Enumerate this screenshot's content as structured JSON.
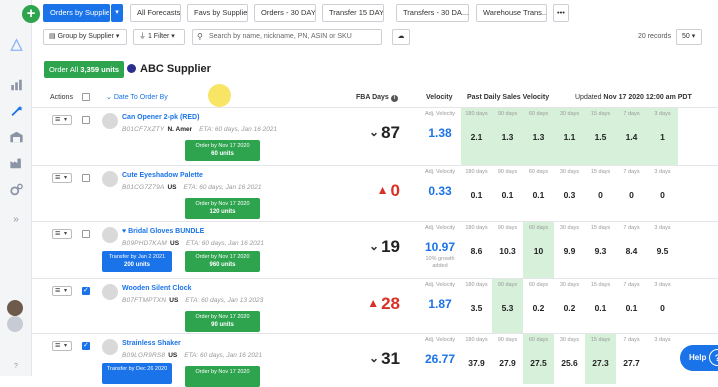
{
  "tabs": [
    {
      "label": "Orders by Supplier",
      "active": true
    },
    {
      "label": "All Forecasts"
    },
    {
      "label": "Favs by Supplier"
    },
    {
      "label": "Orders - 30 DAYS"
    },
    {
      "label": "Transfer 15 DAYS"
    },
    {
      "label": "Transfers - 30 DA..."
    },
    {
      "label": "Warehouse Trans..."
    },
    {
      "label": "•••"
    }
  ],
  "toolbar": {
    "group_label": "Group by Supplier",
    "filter_label": "1 Filter",
    "search_placeholder": "Search by name, nickname, PN, ASIN or SKU",
    "records_label": "20 records",
    "page_size": "50"
  },
  "order_all": {
    "prefix": "Order All",
    "count": "3,359 units"
  },
  "supplier": {
    "name": "ABC Supplier",
    "color": "#2b2f8f"
  },
  "headers": {
    "actions": "Actions",
    "date_to_order": "Date To Order By",
    "fba_days": "FBA Days",
    "velocity": "Velocity",
    "past_velocity": "Past Daily Sales Velocity",
    "updated_prefix": "Updated",
    "updated_value": "Nov 17 2020 12:00 am PDT"
  },
  "period_labels": [
    "180 days",
    "90 days",
    "60 days",
    "30 days",
    "15 days",
    "7 days",
    "3 days"
  ],
  "velocity_label": "Adj. Velocity",
  "help_label": "Help",
  "rows": [
    {
      "name": "Can Opener 2-pk (RED)",
      "asin": "B01CF7XZTY",
      "country": "N. Amer",
      "eta": "ETA: 60 days, Jan 16 2021",
      "checked": false,
      "order_btn": {
        "line1": "Order by Nov 17 2020",
        "line2": "60 units"
      },
      "transfer_btn": null,
      "fba_days": "87",
      "fba_state": "down",
      "velocity": "1.38",
      "growth": "",
      "past": [
        "2.1",
        "1.3",
        "1.3",
        "1.1",
        "1.5",
        "1.4",
        "1"
      ],
      "green": [
        true,
        true,
        true,
        true,
        true,
        true,
        true
      ]
    },
    {
      "name": "Cute Eyeshadow Palette",
      "asin": "B01CG7Z79A",
      "country": "US",
      "eta": "ETA: 60 days, Jan 16 2021",
      "checked": false,
      "order_btn": {
        "line1": "Order by Nov 17 2020",
        "line2": "120 units"
      },
      "transfer_btn": null,
      "fba_days": "0",
      "fba_state": "alert",
      "velocity": "0.33",
      "growth": "",
      "past": [
        "0.1",
        "0.1",
        "0.1",
        "0.3",
        "0",
        "0",
        "0"
      ],
      "green": [
        false,
        false,
        false,
        false,
        false,
        false,
        false
      ]
    },
    {
      "name": "Bridal Gloves BUNDLE",
      "asin": "B09PHD7KAM",
      "country": "US",
      "eta": "ETA: 60 days, Jan 16 2021",
      "checked": false,
      "order_btn": {
        "line1": "Order by Nov 17 2020",
        "line2": "960 units"
      },
      "transfer_btn": {
        "line1": "Transfer by Jan 2 2021",
        "line2": "200 units"
      },
      "fba_days": "19",
      "fba_state": "down",
      "velocity": "10.97",
      "growth": "10% growth added",
      "past": [
        "8.6",
        "10.3",
        "10",
        "9.9",
        "9.3",
        "8.4",
        "9.5"
      ],
      "green": [
        false,
        false,
        true,
        false,
        false,
        false,
        false
      ]
    },
    {
      "name": "Wooden Silent Clock",
      "asin": "B07FTMPTXN",
      "country": "US",
      "eta": "ETA: 60 days, Jan 13 2023",
      "checked": true,
      "order_btn": {
        "line1": "Order by Nov 17 2020",
        "line2": "90 units"
      },
      "transfer_btn": null,
      "fba_days": "28",
      "fba_state": "alert",
      "velocity": "1.87",
      "growth": "",
      "past": [
        "3.5",
        "5.3",
        "0.2",
        "0.2",
        "0.1",
        "0.1",
        "0"
      ],
      "green": [
        false,
        true,
        false,
        false,
        false,
        false,
        false
      ]
    },
    {
      "name": "Strainless Shaker",
      "asin": "B09LGR9RS8",
      "country": "US",
      "eta": "ETA: 60 days, Jan 16 2021",
      "checked": true,
      "order_btn": {
        "line1": "Order by Nov 17 2020",
        "line2": ""
      },
      "transfer_btn": {
        "line1": "Transfer by Dec 26 2020",
        "line2": ""
      },
      "fba_days": "31",
      "fba_state": "down",
      "velocity": "26.77",
      "growth": "",
      "past": [
        "37.9",
        "27.9",
        "27.5",
        "25.6",
        "27.3",
        "27.7",
        ""
      ],
      "green": [
        false,
        false,
        true,
        false,
        true,
        false,
        false
      ]
    }
  ]
}
